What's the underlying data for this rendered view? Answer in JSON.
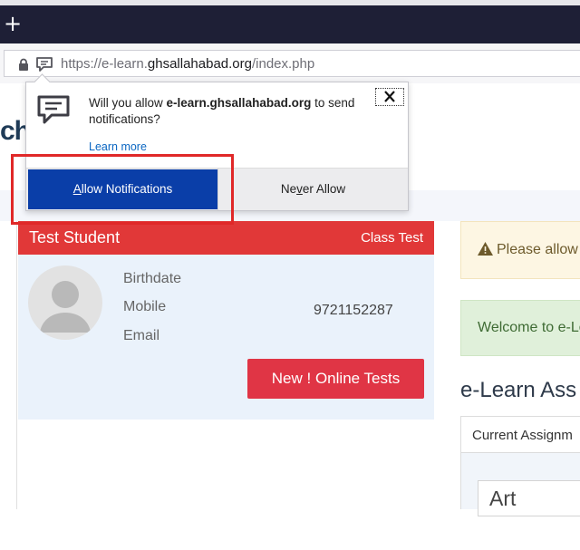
{
  "browser": {
    "new_tab_symbol": "+",
    "url_prefix": "https://e-learn.",
    "url_domain": "ghsallahabad.org",
    "url_path": "/index.php",
    "icons": {
      "lock": "lock-icon",
      "permission": "notification-permission-icon",
      "new_tab": "plus-icon"
    }
  },
  "doorhanger": {
    "message_prefix": "Will you allow ",
    "message_site": "e-learn.ghsallahabad.org",
    "message_suffix": " to send notifications?",
    "learn_more": "Learn more",
    "close_symbol": "X",
    "allow_pre": "",
    "allow_key": "A",
    "allow_post": "llow Notifications",
    "never_pre": "Ne",
    "never_key": "v",
    "never_post": "er Allow",
    "colors": {
      "allow_bg": "#0a3ea8",
      "highlight": "#e02828"
    }
  },
  "page": {
    "header_partial": "ch",
    "student_card": {
      "name": "Test Student",
      "tag": "Class Test",
      "labels": [
        "Birthdate",
        "Mobile",
        "Email"
      ],
      "mobile_value": "9721152287",
      "tests_button": "New ! Online Tests",
      "colors": {
        "header": "#e13838",
        "button": "#e03545"
      }
    },
    "alerts": {
      "warning_text": "Please allow",
      "success_text": "Welcome to e-Le"
    },
    "assignments": {
      "section_title": "e-Learn Ass",
      "tab_label": "Current Assignm",
      "subject": "Art"
    }
  }
}
